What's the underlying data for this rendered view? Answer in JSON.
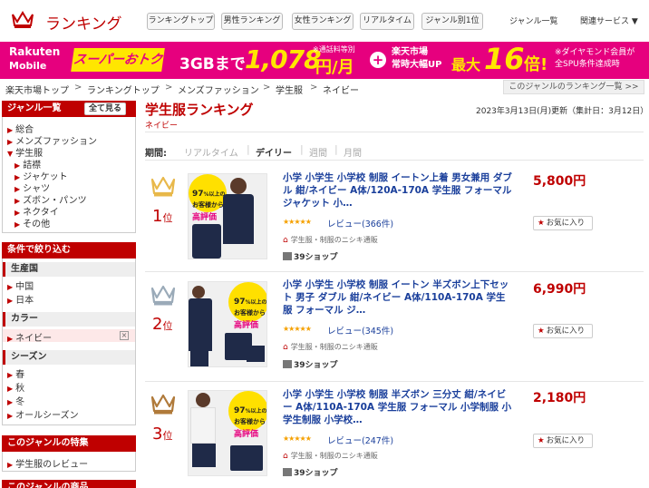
{
  "header": {
    "logo_text": "ランキング",
    "nav_buttons": [
      "ランキングトップ",
      "男性ランキング",
      "女性ランキング",
      "リアルタイム",
      "ジャンル別1位"
    ],
    "nav_links": [
      "ジャンル一覧",
      "関連サービス ▼"
    ]
  },
  "banner": {
    "brand_line1": "Rakuten",
    "brand_line2": "Mobile",
    "campaign": "スーパーおトク",
    "plan": "3GBまで",
    "price": "1,078",
    "price_unit": "円/月",
    "price_note": "※通話料等別",
    "plus": "+",
    "ichiba_line1": "楽天市場",
    "ichiba_line2": "常時大幅UP",
    "max_label": "最大",
    "multiplier": "16",
    "multiplier_unit": "倍!",
    "note_line1": "※ダイヤモンド会員が",
    "note_line2": "全SPU条件達成時"
  },
  "breadcrumb": {
    "items": [
      "楽天市場トップ",
      "ランキングトップ",
      "メンズファッション",
      "学生服",
      "ネイビー"
    ],
    "separator": ">",
    "genre_list_link": "このジャンルのランキング一覧 >>"
  },
  "sidebar": {
    "genre_header": "ジャンル一覧",
    "show_all": "全て見る",
    "genres_top": [
      "総合",
      "メンズファッション",
      "学生服"
    ],
    "genres_sub": [
      "詰襟",
      "ジャケット",
      "シャツ",
      "ズボン・パンツ",
      "ネクタイ",
      "その他"
    ],
    "filter_header": "条件で絞り込む",
    "origin_label": "生産国",
    "origin_items": [
      "中国",
      "日本"
    ],
    "color_label": "カラー",
    "color_items": [
      "ネイビー"
    ],
    "color_clear": "×",
    "season_label": "シーズン",
    "season_items": [
      "春",
      "秋",
      "冬",
      "オールシーズン"
    ],
    "feature_header": "このジャンルの特集",
    "feature_items": [
      "学生服のレビュー"
    ],
    "bottom_header": "このジャンルの商品"
  },
  "main": {
    "title": "学生服ランキング",
    "subtitle": "ネイビー",
    "updated": "2023年3月13日(月)更新（集計日：3月12日）",
    "period_label": "期間:",
    "period_tabs": [
      "リアルタイム",
      "デイリー",
      "週間",
      "月間"
    ],
    "period_sep": "|",
    "fav_label": "お気に入り",
    "star_glyphs": "★★★★★",
    "thumb_percent": "97",
    "thumb_percent_tail": "%以上の",
    "thumb_line2": "お客様から",
    "thumb_line3": "高評価",
    "items": [
      {
        "rank": "1",
        "rank_suffix": "位",
        "title": "小学 小学生 小学校 制服 イートン上着 男女兼用 ダブル 紺/ネイビー A体/120A-170A 学生服 フォーマル ジャケット 小…",
        "price": "5,800円",
        "rating": 4.5,
        "reviews": "レビュー(366件)",
        "shop": "学生服・制服のニシキ通販",
        "shop39": "39ショップ"
      },
      {
        "rank": "2",
        "rank_suffix": "位",
        "title": "小学 小学生 小学校 制服 イートン 半ズボン上下セット 男子 ダブル 紺/ネイビー A体/110A-170A 学生服 フォーマル ジ…",
        "price": "6,990円",
        "rating": 4.5,
        "reviews": "レビュー(345件)",
        "shop": "学生服・制服のニシキ通販",
        "shop39": "39ショップ"
      },
      {
        "rank": "3",
        "rank_suffix": "位",
        "title": "小学 小学生 小学校 制服 半ズボン 三分丈 紺/ネイビー A体/110A-170A 学生服 フォーマル 小学制服 小学生制服 小学校…",
        "price": "2,180円",
        "rating": 4.5,
        "reviews": "レビュー(247件)",
        "shop": "学生服・制服のニシキ通販",
        "shop39": "39ショップ"
      }
    ]
  },
  "colors": {
    "accent": "#bf0000",
    "banner": "#e6007e",
    "gold": "#e8b84a",
    "silver": "#9aaab8",
    "bronze": "#b07a3a",
    "link": "#1a3f9b"
  }
}
